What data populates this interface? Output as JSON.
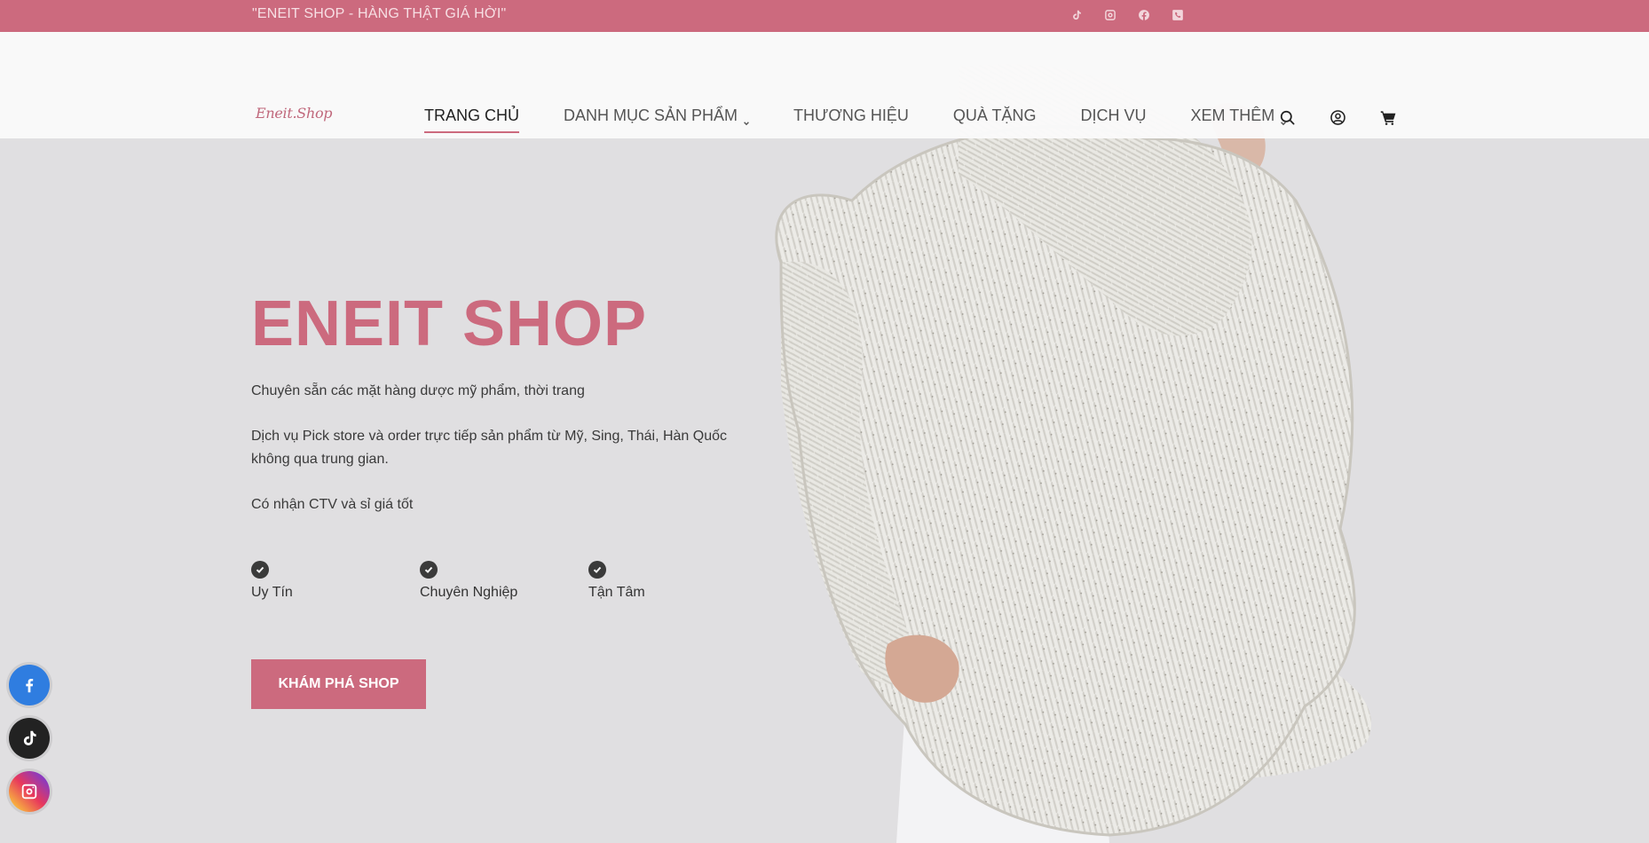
{
  "topbar": {
    "message": "\"ENEIT SHOP - HÀNG THẬT GIÁ HỜI\"",
    "social_icons": [
      "tiktok-icon",
      "instagram-icon",
      "facebook-icon",
      "phone-icon"
    ]
  },
  "header": {
    "logo_text": "Eneit.Shop",
    "nav": [
      {
        "label": "TRANG CHỦ",
        "active": true,
        "dropdown": false
      },
      {
        "label": "DANH MỤC SẢN PHẨM",
        "active": false,
        "dropdown": true
      },
      {
        "label": "THƯƠNG HIỆU",
        "active": false,
        "dropdown": false
      },
      {
        "label": "QUÀ TẶNG",
        "active": false,
        "dropdown": false
      },
      {
        "label": "DỊCH VỤ",
        "active": false,
        "dropdown": false
      },
      {
        "label": "XEM THÊM",
        "active": false,
        "dropdown": true
      }
    ],
    "icons": [
      "search-icon",
      "account-icon",
      "cart-icon"
    ]
  },
  "hero": {
    "title": "ENEIT SHOP",
    "paragraph_1": "Chuyên sẵn các mặt hàng dược mỹ phẩm, thời trang",
    "paragraph_2_line1": "Dịch vụ Pick store và order trực tiếp sản phẩm từ Mỹ, Sing, Thái, Hàn Quốc",
    "paragraph_2_line2": "không qua trung gian.",
    "paragraph_3": "Có nhận CTV và sỉ giá tốt",
    "features": [
      "Uy Tín",
      "Chuyên Nghiệp",
      "Tận Tâm"
    ],
    "cta_label": "KHÁM PHÁ SHOP"
  },
  "floating_social": [
    "facebook-icon",
    "tiktok-icon",
    "instagram-icon"
  ],
  "colors": {
    "brand": "#cc6a7e",
    "hero_bg": "#e0dfe1",
    "text": "#333333"
  }
}
